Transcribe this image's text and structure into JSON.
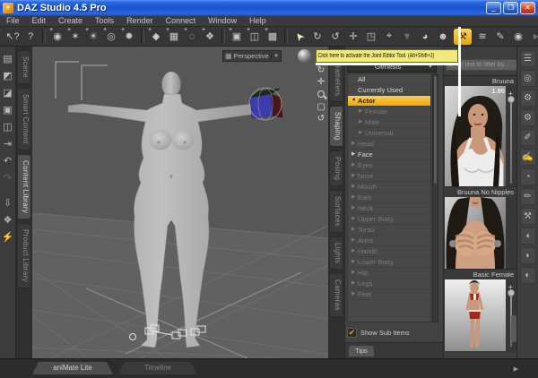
{
  "window": {
    "title": "DAZ Studio 4.5 Pro",
    "controls": {
      "minimize": "_",
      "restore": "❐",
      "close": "✕"
    },
    "logo_glyph": "✦"
  },
  "menu": {
    "items": [
      "File",
      "Edit",
      "Create",
      "Tools",
      "Render",
      "Connect",
      "Window",
      "Help"
    ]
  },
  "toolbar": {
    "tooltip": "Click here to activate the Joint Editor Tool. (Alt+Shift+J)",
    "overflow": "▶",
    "icons": [
      {
        "name": "context-help",
        "glyph": "↖?"
      },
      {
        "name": "whats-this-help",
        "glyph": "?"
      },
      {
        "name": "new-camera",
        "glyph": "◉"
      },
      {
        "name": "new-distant-light",
        "glyph": "✶"
      },
      {
        "name": "new-point-light",
        "glyph": "☀"
      },
      {
        "name": "new-spotlight",
        "glyph": "◎"
      },
      {
        "name": "new-linear-point-light",
        "glyph": "✸"
      },
      {
        "name": "new-primitive",
        "glyph": "◆"
      },
      {
        "name": "new-group",
        "glyph": "▦"
      },
      {
        "name": "new-null",
        "glyph": "◌"
      },
      {
        "name": "new-dformer",
        "glyph": "❖"
      },
      {
        "name": "new-figure",
        "glyph": "▣"
      },
      {
        "name": "new-node",
        "glyph": "◫"
      },
      {
        "name": "new-prop",
        "glyph": "▩"
      },
      {
        "name": "node-selection-tool",
        "glyph": "➤"
      },
      {
        "name": "rotate-tool",
        "glyph": "↻"
      },
      {
        "name": "active-pose-tool",
        "glyph": "↺"
      },
      {
        "name": "translate-tool",
        "glyph": "✛"
      },
      {
        "name": "scale-tool",
        "glyph": "◳"
      },
      {
        "name": "universal-tool",
        "glyph": "⌖"
      },
      {
        "name": "surface-cone-tool",
        "glyph": "▼"
      },
      {
        "name": "surface-selection-tool",
        "glyph": "◕"
      },
      {
        "name": "figure-setup-tool",
        "glyph": "☻"
      },
      {
        "name": "joint-editor-tool",
        "glyph": "⚒"
      },
      {
        "name": "weight-map-brush-tool",
        "glyph": "≋"
      },
      {
        "name": "geometry-editor-tool",
        "glyph": "✎"
      },
      {
        "name": "render-button",
        "glyph": "◉"
      }
    ]
  },
  "left_toolbar": {
    "icons": [
      {
        "name": "new-file",
        "glyph": "▤"
      },
      {
        "name": "open-file",
        "glyph": "◩"
      },
      {
        "name": "merge-file",
        "glyph": "◪"
      },
      {
        "name": "save-file",
        "glyph": "▣"
      },
      {
        "name": "save-as-file",
        "glyph": "◫"
      },
      {
        "name": "import-file",
        "glyph": "⇥"
      },
      {
        "name": "undo",
        "glyph": "↶"
      },
      {
        "name": "redo",
        "glyph": "↷"
      },
      {
        "name": "export-asset",
        "glyph": "⇩"
      },
      {
        "name": "send-to",
        "glyph": "❖"
      },
      {
        "name": "animate-figure",
        "glyph": "⚡"
      }
    ]
  },
  "left_tabs": {
    "items": [
      "Scene",
      "Smart Content",
      "Content Library",
      "Product Library"
    ]
  },
  "viewport": {
    "view_selector": {
      "grid_icon": "▦",
      "label": "Perspective View",
      "arrow": "▼"
    },
    "controls": [
      {
        "name": "orbit-control",
        "glyph": "↻"
      },
      {
        "name": "pan-control",
        "glyph": "✛"
      },
      {
        "name": "zoom-control",
        "glyph": ""
      },
      {
        "name": "frame-control",
        "glyph": "▢"
      },
      {
        "name": "reset-view-control",
        "glyph": "↺"
      }
    ]
  },
  "right_tabs": {
    "items": [
      "Parameters",
      "Shaping",
      "Posing",
      "Surfaces",
      "Lights",
      "Cameras"
    ]
  },
  "shaping": {
    "selector": {
      "label": "Genesis",
      "arrow": "▼"
    },
    "items": [
      {
        "label": "All",
        "arrow": ""
      },
      {
        "label": "Currently Used",
        "arrow": ""
      },
      {
        "label": "Actor",
        "arrow": "▼"
      },
      {
        "label": "Female",
        "arrow": "▶"
      },
      {
        "label": "Male",
        "arrow": "▶"
      },
      {
        "label": "Universal",
        "arrow": "▶"
      },
      {
        "label": "Head",
        "arrow": "▶"
      },
      {
        "label": "Face",
        "arrow": "▶"
      },
      {
        "label": "Eyes",
        "arrow": "▶"
      },
      {
        "label": "Nose",
        "arrow": "▶"
      },
      {
        "label": "Mouth",
        "arrow": "▶"
      },
      {
        "label": "Ears",
        "arrow": "▶"
      },
      {
        "label": "Neck",
        "arrow": "▶"
      },
      {
        "label": "Upper Body",
        "arrow": "▶"
      },
      {
        "label": "Torso",
        "arrow": "▶"
      },
      {
        "label": "Arms",
        "arrow": "▶"
      },
      {
        "label": "Hands",
        "arrow": "▶"
      },
      {
        "label": "Lower Body",
        "arrow": "▶"
      },
      {
        "label": "Hip",
        "arrow": "▶"
      },
      {
        "label": "Legs",
        "arrow": "▶"
      },
      {
        "label": "Feet",
        "arrow": "▶"
      }
    ],
    "footer": {
      "check_glyph": "✔",
      "checkbox_label": "Show Sub Items"
    },
    "tips_tab": "Tips"
  },
  "products": {
    "search": {
      "placeholder": "Enter text to filter by..."
    },
    "items": [
      {
        "name": "Bruuna",
        "value": "1.80",
        "slider_plus": "+"
      },
      {
        "name": "Bruuna No Nipples",
        "value": ""
      },
      {
        "name": "Basic Female",
        "value": "",
        "slider_plus": "+"
      }
    ]
  },
  "right_strip": {
    "icons": [
      {
        "name": "pane-menu",
        "glyph": "☰"
      },
      {
        "name": "activity-target",
        "glyph": "◎"
      },
      {
        "name": "configure-gear",
        "glyph": "⚙"
      },
      {
        "name": "settings-gears",
        "glyph": "⚙"
      },
      {
        "name": "style-pencil",
        "glyph": "✐"
      },
      {
        "name": "figure-edit",
        "glyph": "✍"
      },
      {
        "name": "shader-ball",
        "glyph": "◔"
      },
      {
        "name": "annotate-pencil",
        "glyph": "✏"
      },
      {
        "name": "tool-clamp",
        "glyph": "⚒"
      },
      {
        "name": "morph-arm-a",
        "glyph": "◖"
      },
      {
        "name": "morph-arm-b",
        "glyph": "◗"
      },
      {
        "name": "world-sphere",
        "glyph": "◐"
      }
    ]
  },
  "bottom": {
    "tabs": [
      "aniMate Lite",
      "Timeline"
    ],
    "mini_glyph": "▶"
  },
  "colors": {
    "selection_yellow": "#f2b413",
    "tooltip_bg": "#f0e97c",
    "titlebar_blue": "#1a53cf",
    "viewport_gray": "#575757"
  }
}
